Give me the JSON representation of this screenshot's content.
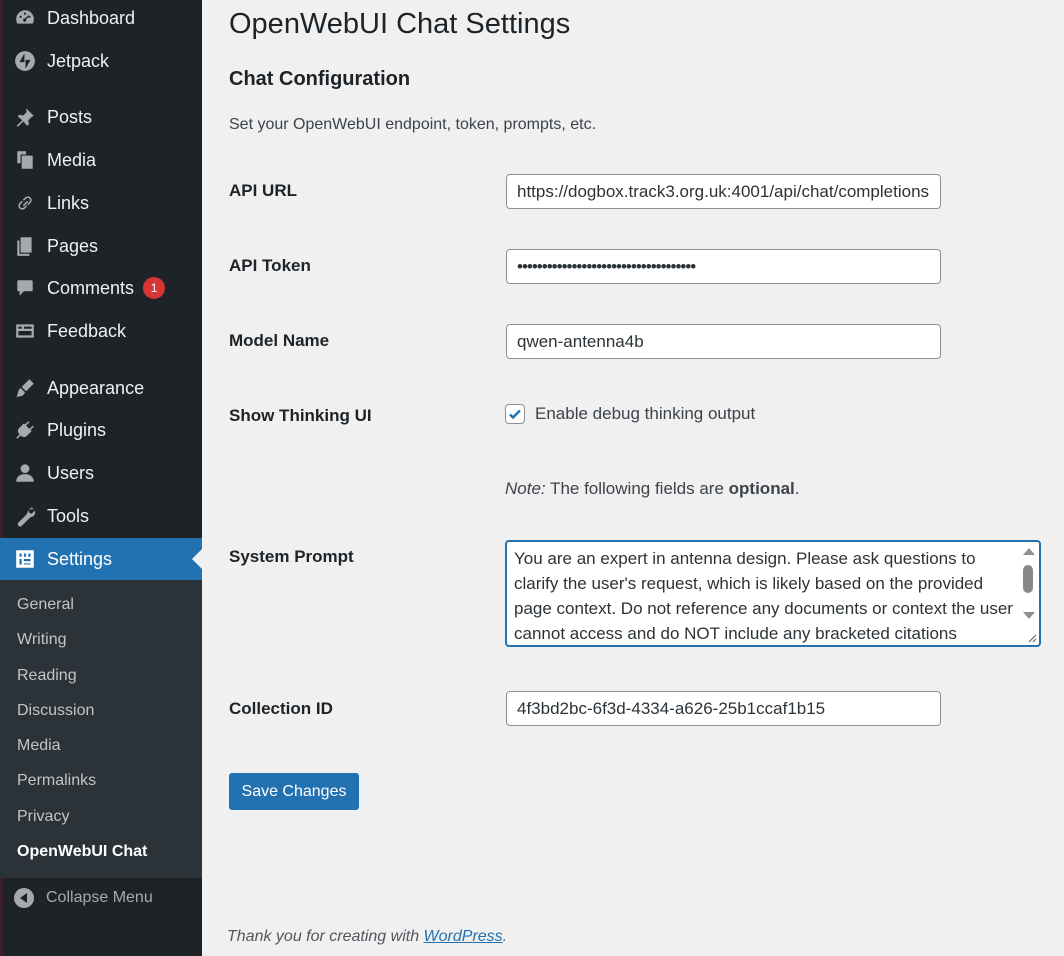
{
  "sidebar": {
    "items": [
      {
        "label": "Dashboard",
        "icon": "dashboard-icon"
      },
      {
        "label": "Jetpack",
        "icon": "jetpack-icon"
      },
      {
        "label": "Posts",
        "icon": "pin-icon"
      },
      {
        "label": "Media",
        "icon": "media-icon"
      },
      {
        "label": "Links",
        "icon": "link-icon"
      },
      {
        "label": "Pages",
        "icon": "pages-icon"
      },
      {
        "label": "Comments",
        "icon": "comment-icon",
        "badge": "1"
      },
      {
        "label": "Feedback",
        "icon": "feedback-icon"
      },
      {
        "label": "Appearance",
        "icon": "brush-icon"
      },
      {
        "label": "Plugins",
        "icon": "plugin-icon"
      },
      {
        "label": "Users",
        "icon": "user-icon"
      },
      {
        "label": "Tools",
        "icon": "wrench-icon"
      },
      {
        "label": "Settings",
        "icon": "settings-icon"
      }
    ],
    "submenu": [
      "General",
      "Writing",
      "Reading",
      "Discussion",
      "Media",
      "Permalinks",
      "Privacy",
      "OpenWebUI Chat"
    ],
    "collapse_label": "Collapse Menu"
  },
  "page": {
    "title": "OpenWebUI Chat Settings",
    "section_title": "Chat Configuration",
    "description": "Set your OpenWebUI endpoint, token, prompts, etc."
  },
  "form": {
    "api_url_label": "API URL",
    "api_url_value": "https://dogbox.track3.org.uk:4001/api/chat/completions",
    "api_token_label": "API Token",
    "api_token_value": "••••••••••••••••••••••••••••••••••••",
    "model_name_label": "Model Name",
    "model_name_value": "qwen-antenna4b",
    "show_thinking_label": "Show Thinking UI",
    "show_thinking_checkbox_label": "Enable debug thinking output",
    "show_thinking_checked": true,
    "note_prefix": "Note:",
    "note_text": " The following fields are ",
    "note_bold": "optional",
    "note_end": ".",
    "system_prompt_label": "System Prompt",
    "system_prompt_value": "You are an expert in antenna design. Please ask questions to clarify the user's request, which is likely based on the provided page context. Do not reference any documents or context the user cannot access and do NOT include any bracketed citations",
    "collection_id_label": "Collection ID",
    "collection_id_value": "4f3bd2bc-6f3d-4334-a626-25b1ccaf1b15",
    "save_label": "Save Changes"
  },
  "footer": {
    "text": "Thank you for creating with ",
    "link": "WordPress",
    "end": "."
  },
  "colors": {
    "accent": "#2271b1",
    "sidebar_bg": "#1d2327",
    "submenu_bg": "#2c3338",
    "badge": "#d63638"
  }
}
